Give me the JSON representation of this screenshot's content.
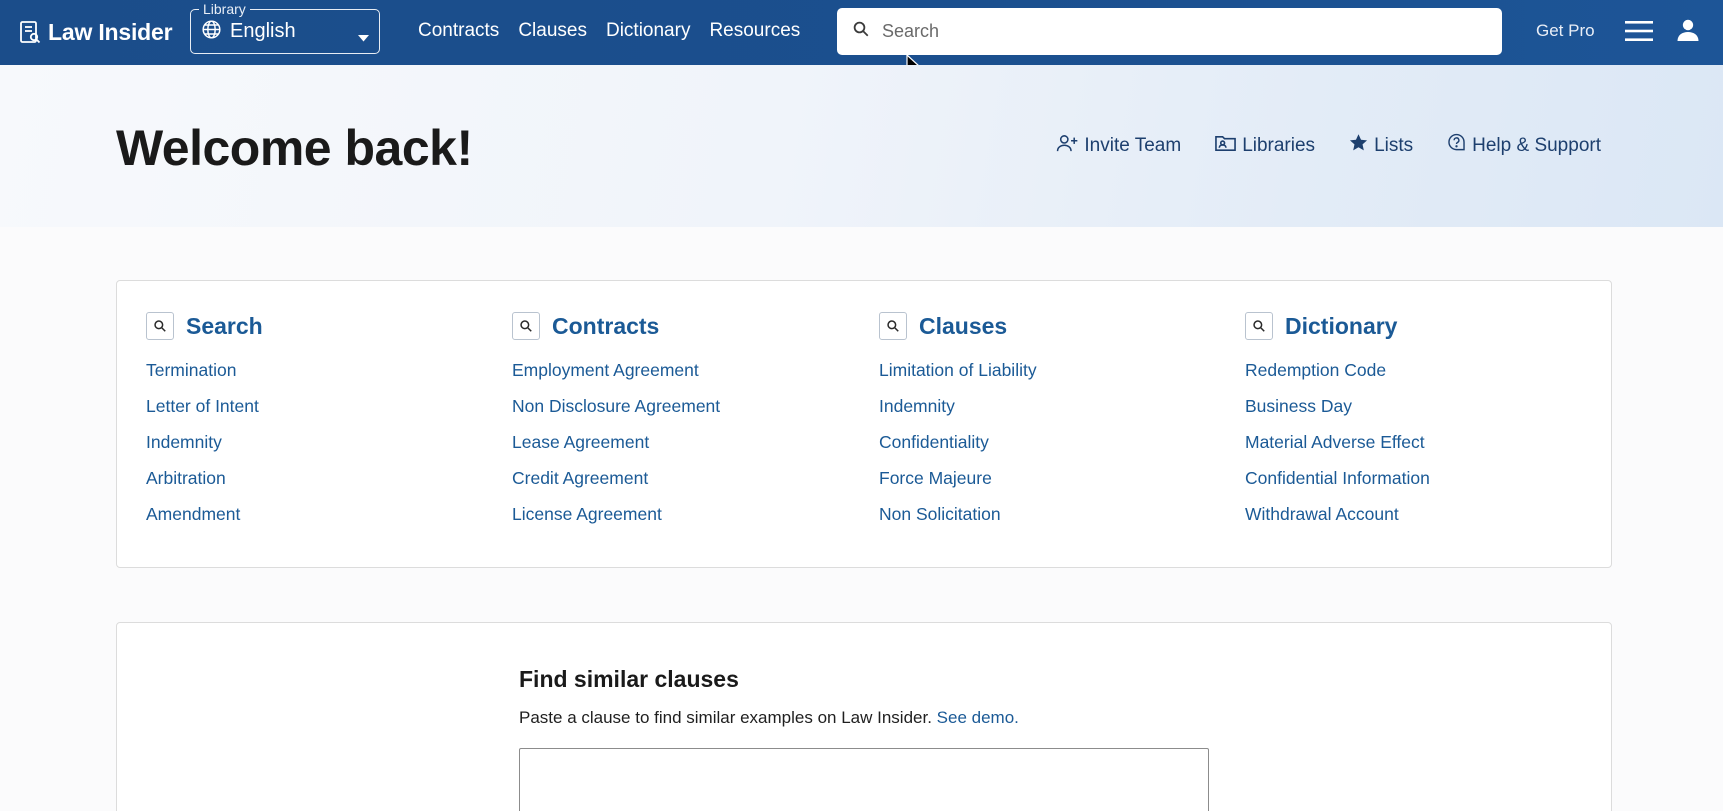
{
  "header": {
    "logo_text": "Law Insider",
    "library": {
      "legend": "Library",
      "value": "English"
    },
    "nav": [
      "Contracts",
      "Clauses",
      "Dictionary",
      "Resources"
    ],
    "search_placeholder": "Search",
    "get_pro": "Get Pro"
  },
  "hero": {
    "title": "Welcome back!",
    "actions": [
      {
        "label": "Invite Team",
        "icon": "user-plus-icon"
      },
      {
        "label": "Libraries",
        "icon": "folder-icon"
      },
      {
        "label": "Lists",
        "icon": "star-icon"
      },
      {
        "label": "Help & Support",
        "icon": "help-icon"
      }
    ]
  },
  "quick_links": [
    {
      "title": "Search",
      "items": [
        "Termination",
        "Letter of Intent",
        "Indemnity",
        "Arbitration",
        "Amendment"
      ]
    },
    {
      "title": "Contracts",
      "items": [
        "Employment Agreement",
        "Non Disclosure Agreement",
        "Lease Agreement",
        "Credit Agreement",
        "License Agreement"
      ]
    },
    {
      "title": "Clauses",
      "items": [
        "Limitation of Liability",
        "Indemnity",
        "Confidentiality",
        "Force Majeure",
        "Non Solicitation"
      ]
    },
    {
      "title": "Dictionary",
      "items": [
        "Redemption Code",
        "Business Day",
        "Material Adverse Effect",
        "Confidential Information",
        "Withdrawal Account"
      ]
    }
  ],
  "find_similar": {
    "title": "Find similar clauses",
    "description": "Paste a clause to find similar examples on Law Insider.",
    "demo_link": "See demo."
  },
  "colors": {
    "header_bg": "#1b4d8a",
    "link": "#1b5a96",
    "hero_action": "#1d3f6e"
  }
}
